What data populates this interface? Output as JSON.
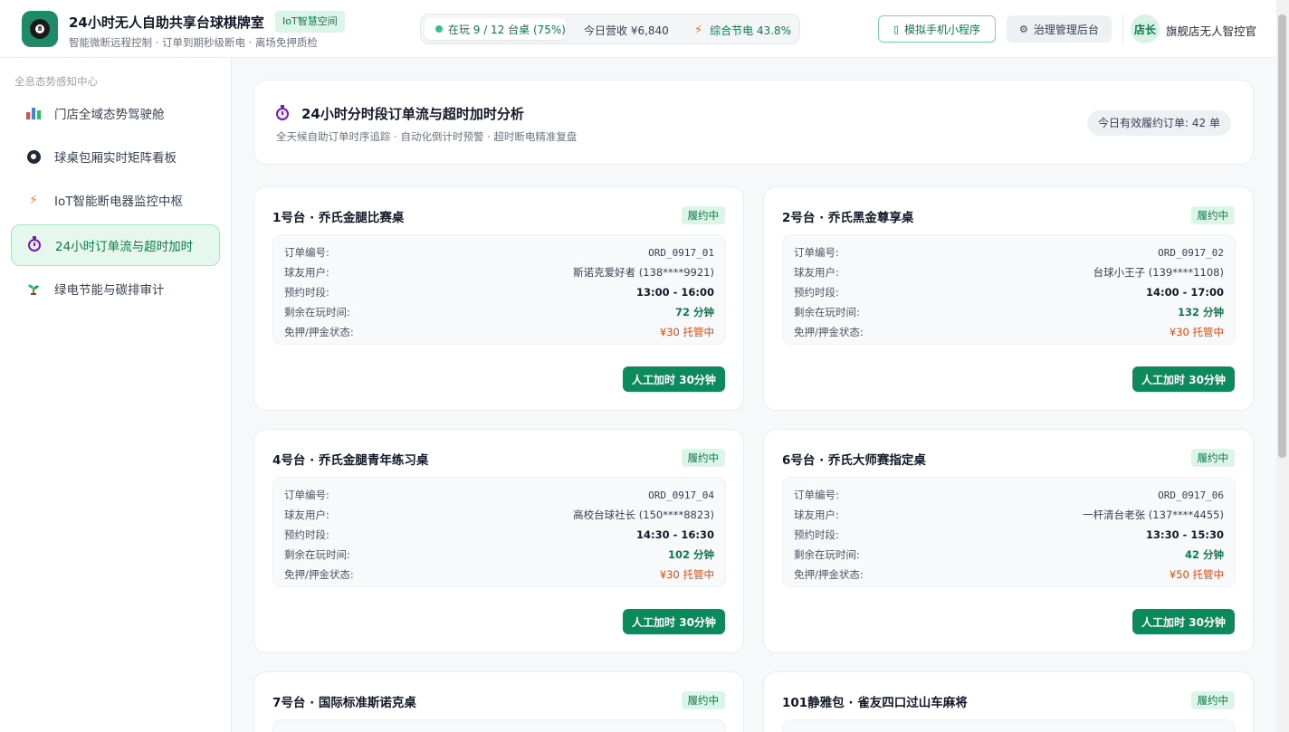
{
  "header": {
    "app_title": "24小时无人自助共享台球棋牌室",
    "badge": "IoT智慧空间",
    "subtitle": "智能微断远程控制 · 订单到期秒级断电 · 离场免押质检",
    "stats": {
      "playing": "在玩 9 / 12 台桌 (75%)",
      "revenue": "今日营收 ¥6,840",
      "energy": "综合节电 43.8%"
    },
    "mini_program_button": "模拟手机小程序",
    "admin_button": "治理管理后台",
    "avatar_text": "店长",
    "user_name": "旗舰店无人智控官"
  },
  "sidebar": {
    "heading": "全息态势感知中心",
    "items": [
      {
        "label": "门店全域态势驾驶舱",
        "icon": "bar-chart-icon"
      },
      {
        "label": "球桌包厢实时矩阵看板",
        "icon": "billiard-ball-icon"
      },
      {
        "label": "IoT智能断电器监控中枢",
        "icon": "lightning-icon"
      },
      {
        "label": "24小时订单流与超时加时",
        "icon": "stopwatch-icon",
        "active": true
      },
      {
        "label": "绿电节能与碳排审计",
        "icon": "seedling-icon"
      }
    ]
  },
  "main": {
    "title": "24小时分时段订单流与超时加时分析",
    "subtitle": "全天候自助订单时序追踪 · 自动化倒计时预警 · 超时断电精准复盘",
    "today_badge": "今日有效履约订单: 42 单",
    "labels": {
      "order_no": "订单编号:",
      "user": "球友用户:",
      "slot": "预约时段:",
      "remaining": "剩余在玩时间:",
      "deposit": "免押/押金状态:",
      "add_time": "人工加时 30分钟"
    },
    "cards": [
      {
        "title": "1号台 · 乔氏金腿比赛桌",
        "status": "履约中",
        "order_no": "ORD_0917_01",
        "user": "斯诺克爱好者 (138****9921)",
        "slot": "13:00 - 16:00",
        "remaining": "72 分钟",
        "deposit": "¥30 托管中"
      },
      {
        "title": "2号台 · 乔氏黑金尊享桌",
        "status": "履约中",
        "order_no": "ORD_0917_02",
        "user": "台球小王子 (139****1108)",
        "slot": "14:00 - 17:00",
        "remaining": "132 分钟",
        "deposit": "¥30 托管中"
      },
      {
        "title": "4号台 · 乔氏金腿青年练习桌",
        "status": "履约中",
        "order_no": "ORD_0917_04",
        "user": "高校台球社长 (150****8823)",
        "slot": "14:30 - 16:30",
        "remaining": "102 分钟",
        "deposit": "¥30 托管中"
      },
      {
        "title": "6号台 · 乔氏大师赛指定桌",
        "status": "履约中",
        "order_no": "ORD_0917_06",
        "user": "一杆清台老张 (137****4455)",
        "slot": "13:30 - 15:30",
        "remaining": "42 分钟",
        "deposit": "¥50 托管中"
      },
      {
        "title": "7号台 · 国际标准斯诺克桌",
        "status": "履约中"
      },
      {
        "title": "101静雅包 · 雀友四口过山车麻将",
        "status": "履约中"
      }
    ]
  },
  "colors": {
    "brand": "#0d8a5c",
    "active_bg": "#e6f7ee",
    "warning": "#d9480f"
  }
}
